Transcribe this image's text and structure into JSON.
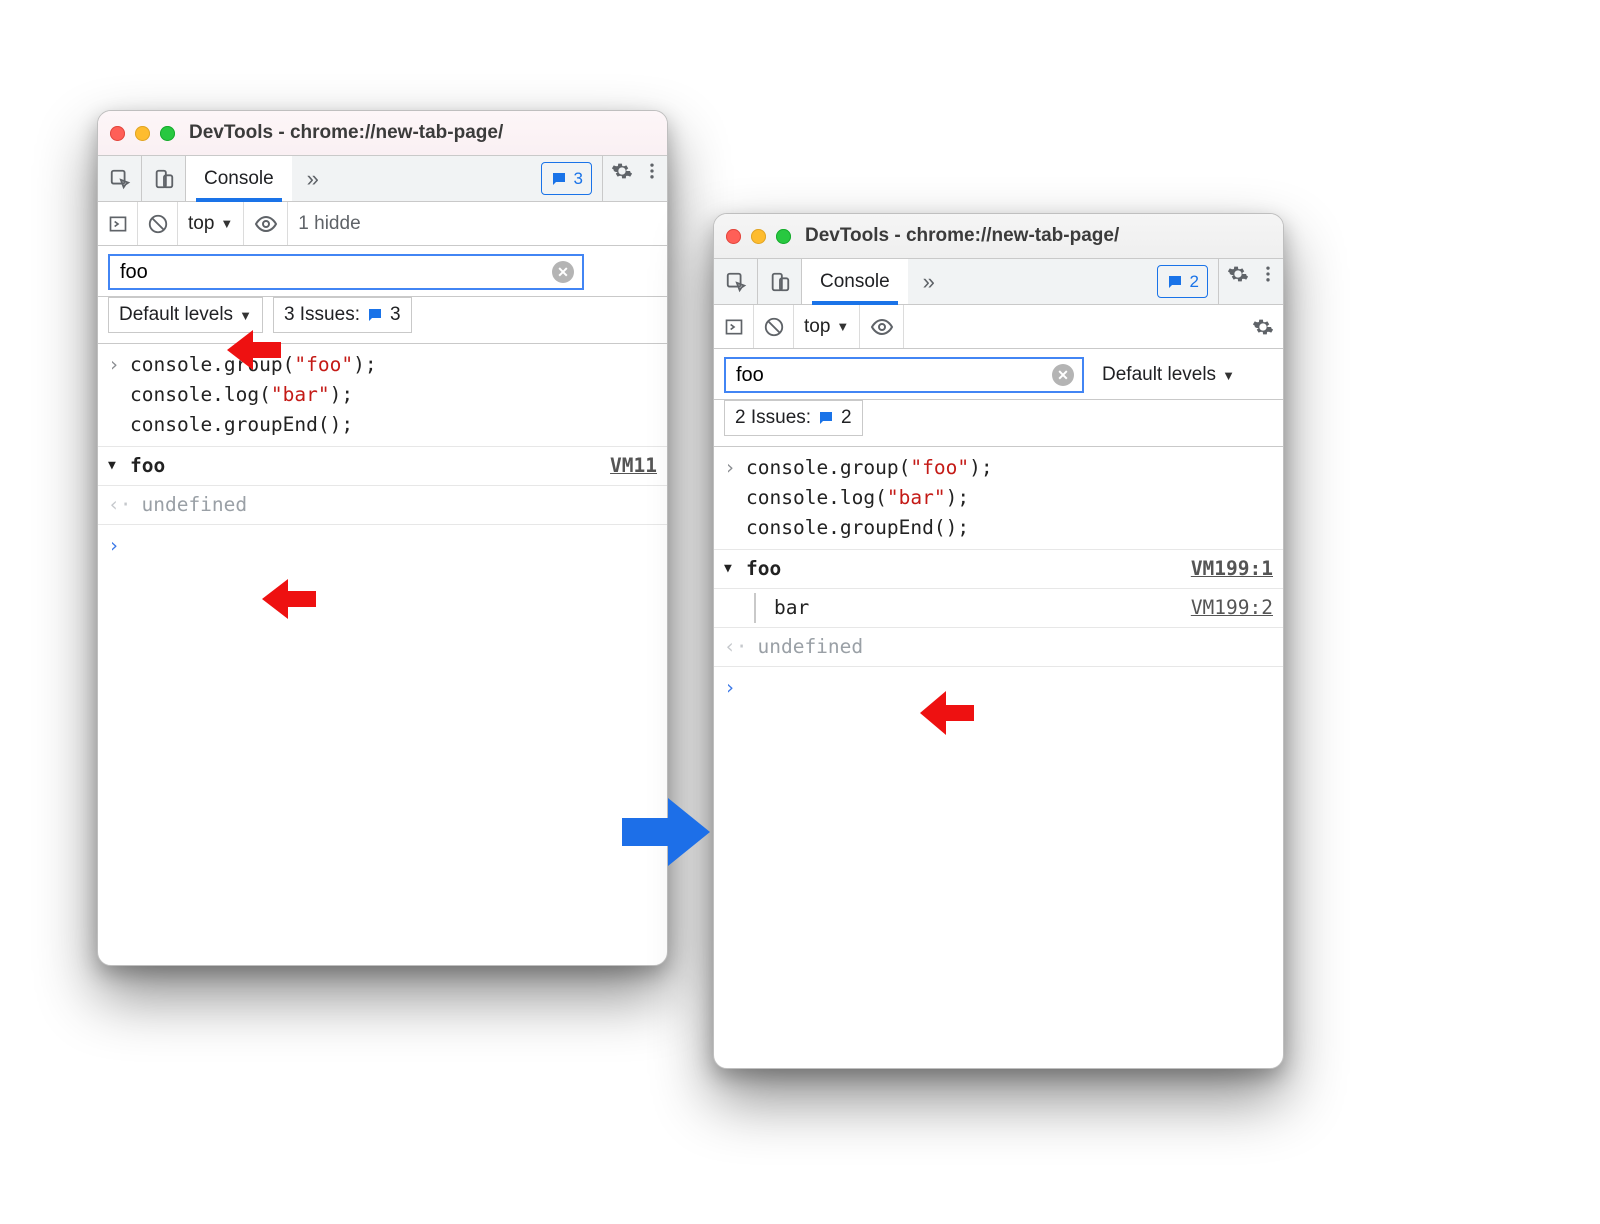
{
  "windows": {
    "left": {
      "title": "DevTools - chrome://new-tab-page/",
      "tab": "Console",
      "badge_count": "3",
      "context": "top",
      "hidden_text": "1 hidde",
      "filter_value": "foo",
      "levels_label": "Default levels",
      "issues_label": "3 Issues:",
      "issues_count": "3",
      "code_lines": [
        "console.group(\"foo\");",
        "console.log(\"bar\");",
        "console.groupEnd();"
      ],
      "group_label": "foo",
      "group_source": "VM11",
      "undefined_label": "undefined"
    },
    "right": {
      "title": "DevTools - chrome://new-tab-page/",
      "tab": "Console",
      "badge_count": "2",
      "context": "top",
      "filter_value": "foo",
      "levels_label": "Default levels",
      "issues_label": "2 Issues:",
      "issues_count": "2",
      "code_lines": [
        "console.group(\"foo\");",
        "console.log(\"bar\");",
        "console.groupEnd();"
      ],
      "group_label": "foo",
      "group_source": "VM199:1",
      "child_label": "bar",
      "child_source": "VM199:2",
      "undefined_label": "undefined"
    }
  }
}
